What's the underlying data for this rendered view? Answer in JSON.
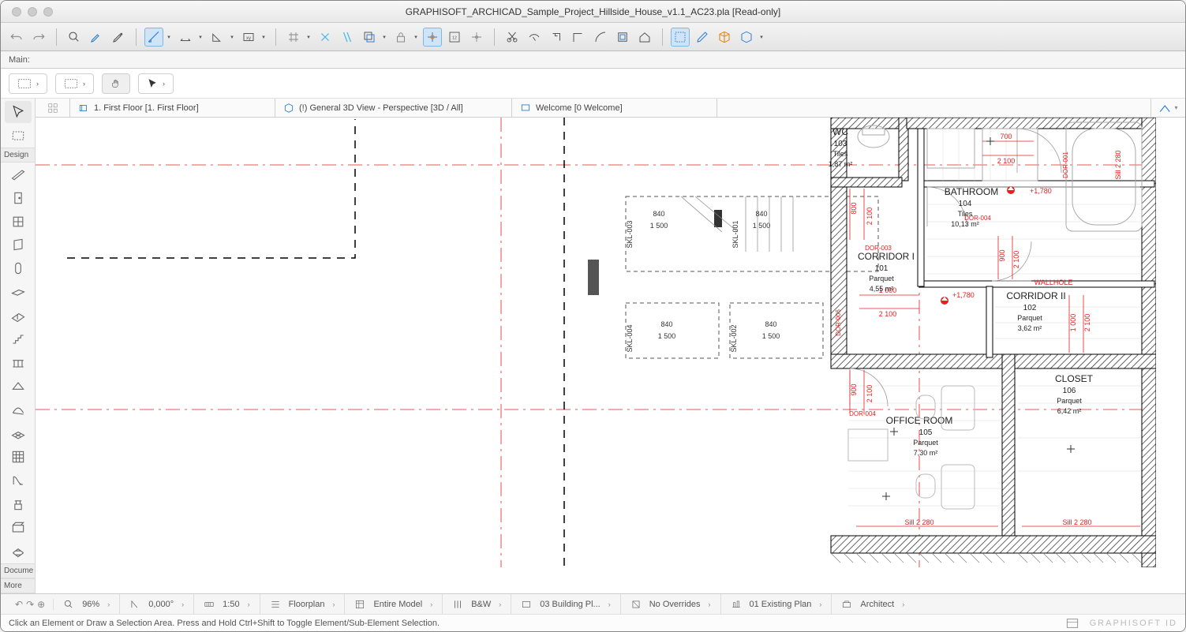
{
  "window": {
    "title": "GRAPHISOFT_ARCHICAD_Sample_Project_Hillside_House_v1.1_AC23.pla [Read-only]"
  },
  "subheader": {
    "label": "Main:"
  },
  "tabs": {
    "t1": "1. First Floor [1. First Floor]",
    "t2": "(!) General 3D View - Perspective [3D / All]",
    "t3": "Welcome [0 Welcome]"
  },
  "toolbox": {
    "section_design": "Design",
    "section_docume": "Docume",
    "section_more": "More"
  },
  "statusbar": {
    "zoom": "96%",
    "angle": "0,000°",
    "scale": "1:50",
    "view_type": "Floorplan",
    "model_filter": "Entire Model",
    "penset": "B&W",
    "building_plan": "03 Building Pl...",
    "overrides": "No Overrides",
    "workplan": "01 Existing Plan",
    "role": "Architect"
  },
  "hintbar": {
    "hint": "Click an Element or Draw a Selection Area. Press and Hold Ctrl+Shift to Toggle Element/Sub-Element Selection.",
    "brand": "GRAPHISOFT ID"
  },
  "rooms": {
    "wc": {
      "name": "WC",
      "num": "103",
      "mat": "Tiles",
      "area": "1,87 m²"
    },
    "bath": {
      "name": "BATHROOM",
      "num": "104",
      "mat": "Tiles",
      "area": "10,13 m²"
    },
    "corr1": {
      "name": "CORRIDOR I",
      "num": "101",
      "mat": "Parquet",
      "area": "4,55 m²"
    },
    "corr2": {
      "name": "CORRIDOR II",
      "num": "102",
      "mat": "Parquet",
      "area": "3,62 m²"
    },
    "office": {
      "name": "OFFICE ROOM",
      "num": "105",
      "mat": "Parquet",
      "area": "7,30 m²"
    },
    "closet": {
      "name": "CLOSET",
      "num": "106",
      "mat": "Parquet",
      "area": "6,42 m²"
    }
  },
  "dims": {
    "d700": "700",
    "d2100": "2 100",
    "d800": "800",
    "d900": "900",
    "d1000": "1 000",
    "lvl1780": "+1,780",
    "dor001": "DOR-001",
    "dor003": "DOR-003",
    "dor004": "DOR-004",
    "dor006": "DOR-006",
    "wallhole": "WALLHOLE",
    "sill": "Sill 2 280"
  },
  "skylights": {
    "w": "840",
    "h": "1 500",
    "skl002": "SKL-002",
    "skl003": "SKL-003",
    "skl004": "SKL-004",
    "skl001": "SKL-001"
  }
}
